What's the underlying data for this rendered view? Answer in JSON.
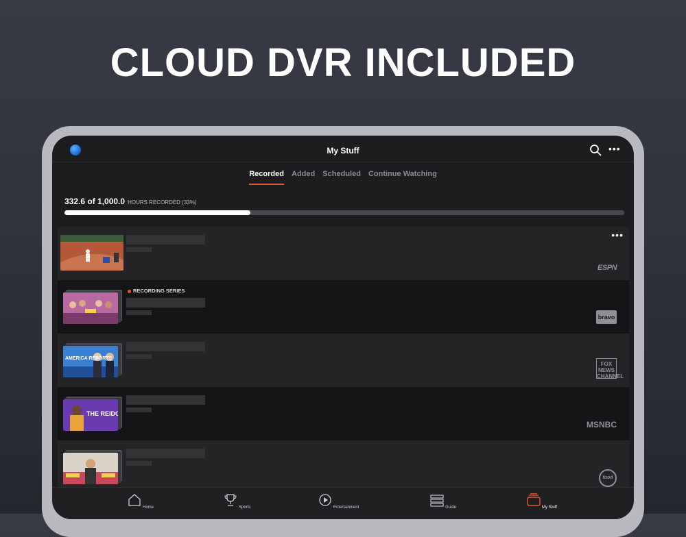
{
  "hero": {
    "headline": "CLOUD DVR INCLUDED"
  },
  "topbar": {
    "title": "My Stuff",
    "more_label": "•••"
  },
  "tabs": [
    {
      "label": "Recorded",
      "active": true
    },
    {
      "label": "Added",
      "active": false
    },
    {
      "label": "Scheduled",
      "active": false
    },
    {
      "label": "Continue Watching",
      "active": false
    }
  ],
  "storage": {
    "used_text": "332.6 of 1,000.0",
    "unit_text": "HOURS RECORDED (33%)",
    "percent": 33.26
  },
  "recordings": [
    {
      "network": "ESPN",
      "status": "",
      "more_label": "•••",
      "thumb": "baseball-game"
    },
    {
      "network": "bravo",
      "status": "RECORDING SERIES",
      "thumb": "bravo-show"
    },
    {
      "network": "FOX NEWS CHANNEL",
      "status": "",
      "thumb": "america-reports"
    },
    {
      "network": "MSNBC",
      "status": "",
      "thumb": "the-reidout"
    },
    {
      "network": "food",
      "status": "",
      "thumb": "food-show"
    }
  ],
  "thumb_text": {
    "america_reports": "AMERICA REPORTS",
    "reidout": "THE REIDOUT"
  },
  "bottom_nav": [
    {
      "label": "Home",
      "icon": "home-icon",
      "active": false
    },
    {
      "label": "Sports",
      "icon": "trophy-icon",
      "active": false
    },
    {
      "label": "Entertainment",
      "icon": "play-icon",
      "active": false
    },
    {
      "label": "Guide",
      "icon": "guide-icon",
      "active": false
    },
    {
      "label": "My Stuff",
      "icon": "my-stuff-icon",
      "active": true
    }
  ],
  "colors": {
    "accent": "#e8552d",
    "background": "#1d1d1f",
    "logo": "#1f6fd6"
  }
}
